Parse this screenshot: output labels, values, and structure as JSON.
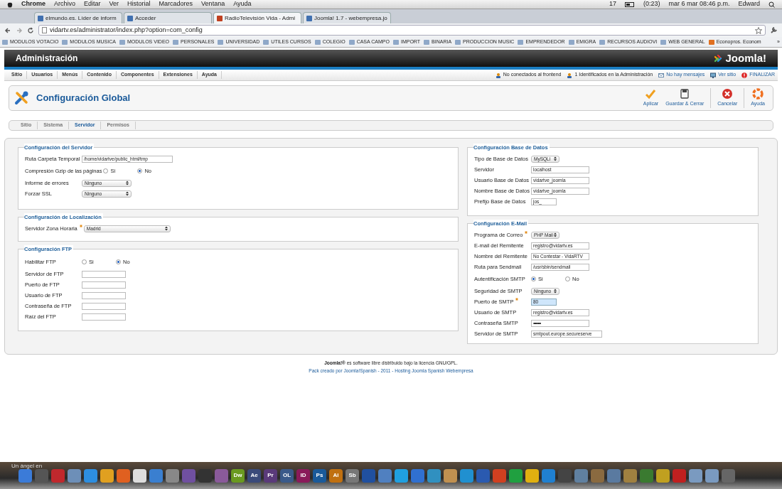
{
  "menubar": {
    "app": "Chrome",
    "menus": [
      "Archivo",
      "Editar",
      "Ver",
      "Historial",
      "Marcadores",
      "Ventana",
      "Ayuda"
    ],
    "status": [
      "17",
      "(0:23)",
      "mar 6 mar  08:46 p.m.",
      "Edward"
    ]
  },
  "tabs": [
    {
      "label": "elmundo.es. Líder de inform",
      "selected": false
    },
    {
      "label": "Acceder",
      "selected": false
    },
    {
      "label": "RadioTelevisión Vida - Admi",
      "selected": true
    },
    {
      "label": "Joomla! 1.7 - webempresa.jo",
      "selected": false
    }
  ],
  "address": "vidartv.es/administrator/index.php?option=com_config",
  "bookmarks": [
    "MODULOS VOTACIO",
    "MODULOS MUSICA",
    "MODULOS VIDEO",
    "PERSONALES",
    "UNIVERSIDAD",
    "UTILES CURSOS",
    "COLEGIO",
    "CASA CAMPO",
    "IMPORT",
    "BINARIA",
    "PRODUCCION MUSIC",
    "EMPRENDEDOR",
    "EMIGRA",
    "RECURSOS AUDIOVI",
    "WEB GENERAL",
    "Econopros. Econom"
  ],
  "more_bookmarks": "»",
  "admin": {
    "title": "Administración",
    "logo": "Joomla!"
  },
  "menu": [
    "Sitio",
    "Usuarios",
    "Menús",
    "Contenido",
    "Componentes",
    "Extensiones",
    "Ayuda"
  ],
  "status_links": [
    {
      "label": "No conectados al frontend",
      "kind": "user"
    },
    {
      "label": "1 Identificados en la Administración",
      "kind": "user"
    },
    {
      "label": "No hay mensajes",
      "kind": "mail"
    },
    {
      "label": "Ver sitio",
      "kind": "screen"
    },
    {
      "label": "FINALIZAR",
      "kind": "logout"
    }
  ],
  "page_title": "Configuración Global",
  "toolbar": [
    {
      "label": "Aplicar",
      "kind": "apply"
    },
    {
      "label": "Guardar & Cerrar",
      "kind": "save"
    },
    {
      "label": "Cancelar",
      "kind": "cancel"
    },
    {
      "label": "Ayuda",
      "kind": "help"
    }
  ],
  "subtabs": [
    {
      "label": "Sitio",
      "selected": false
    },
    {
      "label": "Sistema",
      "selected": false
    },
    {
      "label": "Servidor",
      "selected": true
    },
    {
      "label": "Permisos",
      "selected": false
    }
  ],
  "columns": [
    [
      {
        "legend": "Configuración del Servidor",
        "fields": [
          {
            "label": "Ruta Carpeta Temporal",
            "kind": "text",
            "value": "/home/vidartve/public_html/tmp"
          },
          {
            "label": "Compresión Gzip de las páginas",
            "kind": "radio",
            "options": [
              {
                "label": "Si",
                "selected": false
              },
              {
                "label": "No",
                "selected": true
              }
            ]
          },
          {
            "label": "Informe de errores",
            "kind": "select",
            "value": "Ninguno"
          },
          {
            "label": "Forzar SSL",
            "kind": "select",
            "value": "Ninguno"
          }
        ]
      },
      {
        "legend": "Configuración de Localización",
        "fields": [
          {
            "label": "Servidor Zona Horaria",
            "required": true,
            "kind": "select",
            "value": "Madrid"
          }
        ]
      },
      {
        "legend": "Configuración FTP",
        "fields": [
          {
            "label": "Habilitar FTP",
            "kind": "radio",
            "options": [
              {
                "label": "Si",
                "selected": false
              },
              {
                "label": "No",
                "selected": true
              }
            ]
          },
          {
            "label": "Servidor de FTP",
            "kind": "text"
          },
          {
            "label": "Puerto de FTP",
            "kind": "text"
          },
          {
            "label": "Usuario de FTP",
            "kind": "text"
          },
          {
            "label": "Contraseña de FTP",
            "kind": "text"
          },
          {
            "label": "Raíz del FTP",
            "kind": "text"
          }
        ]
      }
    ],
    [
      {
        "legend": "Configuración Base de Datos",
        "fields": [
          {
            "label": "Tipo de Base de Datos",
            "kind": "select",
            "value": "MySQLi"
          },
          {
            "label": "Servidor",
            "kind": "text",
            "value": "localhost"
          },
          {
            "label": "Usuario Base de Datos",
            "kind": "text",
            "value": "vidartve_joomla"
          },
          {
            "label": "Nombre Base de Datos",
            "kind": "text",
            "value": "vidartve_joomla"
          },
          {
            "label": "Prefijo Base de Datos",
            "kind": "text",
            "value": "jos_"
          }
        ]
      },
      {
        "legend": "Configuración E-Mail",
        "fields": [
          {
            "label": "Programa de Correo",
            "required": true,
            "kind": "select",
            "value": "PHP Mail"
          },
          {
            "label": "E-mail del Remitente",
            "kind": "text",
            "value": "registro@vidartv.es"
          },
          {
            "label": "Nombre del Remitente",
            "kind": "text",
            "value": "No Contestar - VidaRTV"
          },
          {
            "label": "Ruta para Sendmail",
            "kind": "text",
            "value": "/usr/sbin/sendmail"
          },
          {
            "label": "Autentificación SMTP",
            "kind": "radio",
            "options": [
              {
                "label": "Si",
                "selected": true
              },
              {
                "label": "No",
                "selected": false
              }
            ]
          },
          {
            "label": "Seguridad de SMTP",
            "kind": "select",
            "value": "Ninguno"
          },
          {
            "label": "Puerto de SMTP",
            "required": true,
            "kind": "text",
            "value": "80",
            "focused": true
          },
          {
            "label": "Usuario de SMTP",
            "kind": "text",
            "value": "registro@vidartv.es"
          },
          {
            "label": "Contraseña SMTP",
            "kind": "password",
            "value": "••••••••"
          },
          {
            "label": "Servidor de SMTP",
            "kind": "text",
            "value": "smtpout.europe.secureserve"
          }
        ]
      }
    ]
  ],
  "footer": [
    {
      "text": "**Joomla!®** es software libre distribuido bajo la licencia GNU/GPL.",
      "kind": "note"
    },
    {
      "text": "Pack creado por Joomla!Spanish - 2011 - Hosting Joomla Spanish Webempresa",
      "kind": "link"
    }
  ],
  "desktop_label": "Un ángel en",
  "dock": [
    {
      "color": "#3b7bd8"
    },
    {
      "color": "#555555"
    },
    {
      "color": "#c0282d"
    },
    {
      "color": "#6d8fb8"
    },
    {
      "color": "#2d8ee0"
    },
    {
      "color": "#e0a020"
    },
    {
      "color": "#e06020"
    },
    {
      "color": "#dddddd"
    },
    {
      "color": "#3a7fd0"
    },
    {
      "color": "#888888"
    },
    {
      "color": "#7050a0"
    },
    {
      "color": "#333333"
    },
    {
      "color": "#8a5a9a"
    },
    {
      "color": "#6a9a20",
      "label": "Dw"
    },
    {
      "color": "#3a4a7a",
      "label": "Ae"
    },
    {
      "color": "#5a3a7a",
      "label": "Pr"
    },
    {
      "color": "#3a5a8a",
      "label": "OL"
    },
    {
      "color": "#8a1a5a",
      "label": "ID"
    },
    {
      "color": "#1a5a9a",
      "label": "Ps"
    },
    {
      "color": "#c07010",
      "label": "Ai"
    },
    {
      "color": "#777777",
      "label": "Sb"
    },
    {
      "color": "#2050a0"
    },
    {
      "color": "#5080c0"
    },
    {
      "color": "#20a0e0"
    },
    {
      "color": "#3070d0"
    },
    {
      "color": "#3090c0"
    },
    {
      "color": "#c09050"
    },
    {
      "color": "#2090d0"
    },
    {
      "color": "#2a5ab0"
    },
    {
      "color": "#d04020"
    },
    {
      "color": "#20a040"
    },
    {
      "color": "#e0b010"
    },
    {
      "color": "#2080d0"
    },
    {
      "color": "#444444"
    },
    {
      "color": "#6080a0"
    },
    {
      "color": "#8a6a40"
    },
    {
      "color": "#5a7aa0"
    },
    {
      "color": "#a08040"
    },
    {
      "color": "#3a7a30"
    },
    {
      "color": "#c0a020"
    },
    {
      "color": "#c02020"
    },
    {
      "color": "#7a9ac0"
    },
    {
      "color": "#7a9ac0"
    },
    {
      "color": "#666666"
    }
  ]
}
